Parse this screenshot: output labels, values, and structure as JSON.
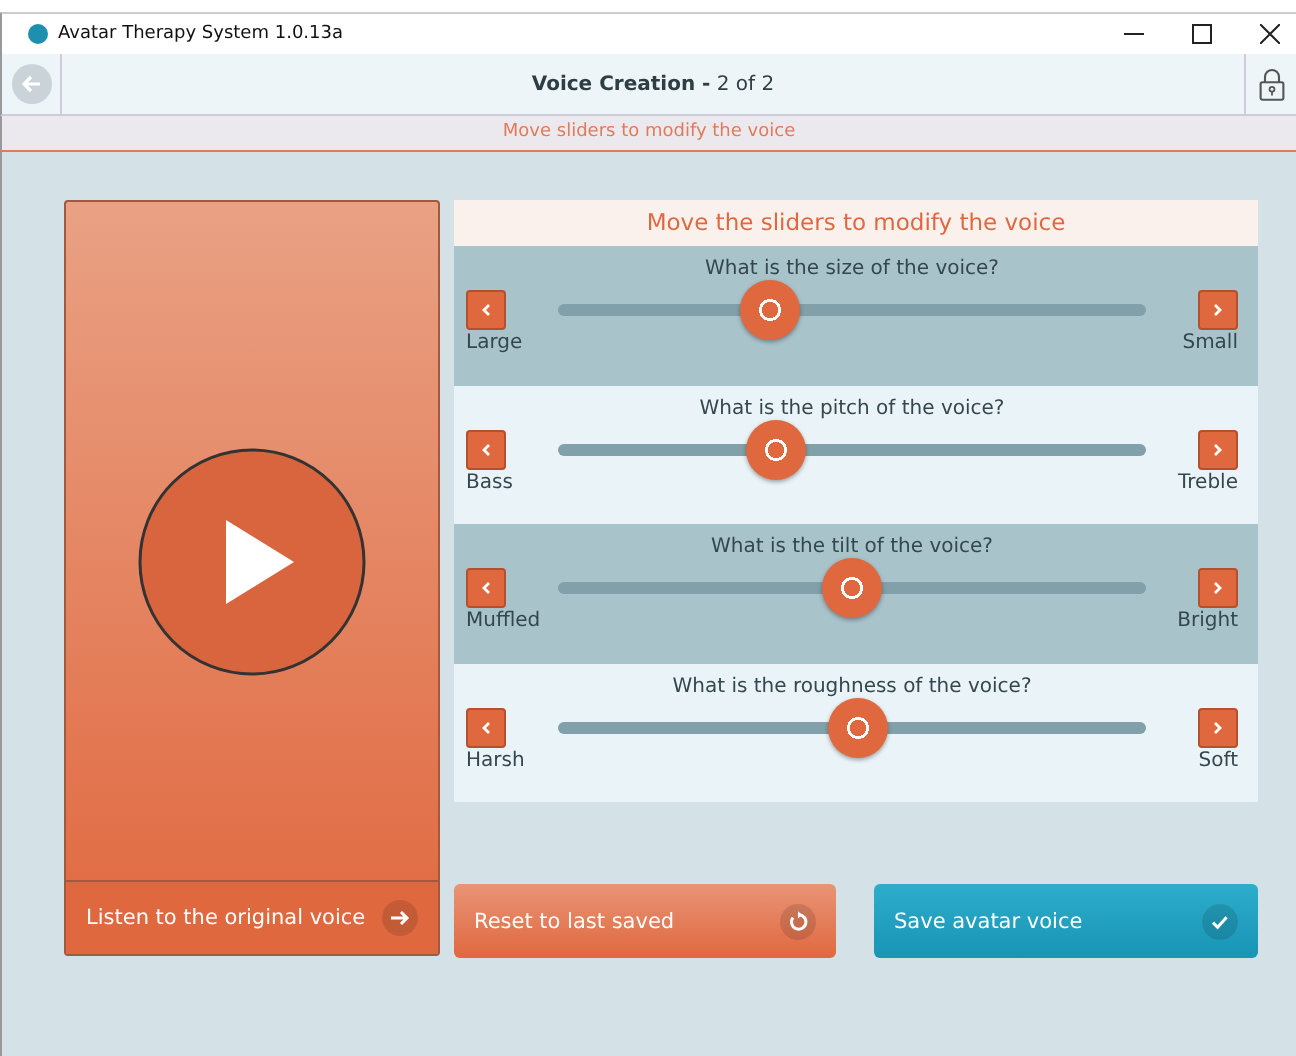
{
  "window": {
    "title": "Avatar Therapy System 1.0.13a"
  },
  "header": {
    "title": "**Voice Creation -** 2 of 2"
  },
  "instruction_bar": "Move sliders to modify the voice",
  "panel_title": "Move the sliders to modify the voice",
  "sliders": [
    {
      "question": "What is the size of the voice?",
      "left": "Large",
      "right": "Small",
      "level": 0.36
    },
    {
      "question": "What is the pitch of the voice?",
      "left": "Bass",
      "right": "Treble",
      "level": 0.37
    },
    {
      "question": "What is the tilt of the voice?",
      "left": "Muffled",
      "right": "Bright",
      "level": 0.5
    },
    {
      "question": "What is the roughness of the voice?",
      "left": "Harsh",
      "right": "Soft",
      "level": 0.51
    }
  ],
  "buttons": [
    {
      "kind": "listen",
      "label": "Listen to the original voice"
    },
    {
      "kind": "reset",
      "label": "Reset to last saved"
    },
    {
      "kind": "save",
      "label": "Save avatar voice"
    }
  ]
}
